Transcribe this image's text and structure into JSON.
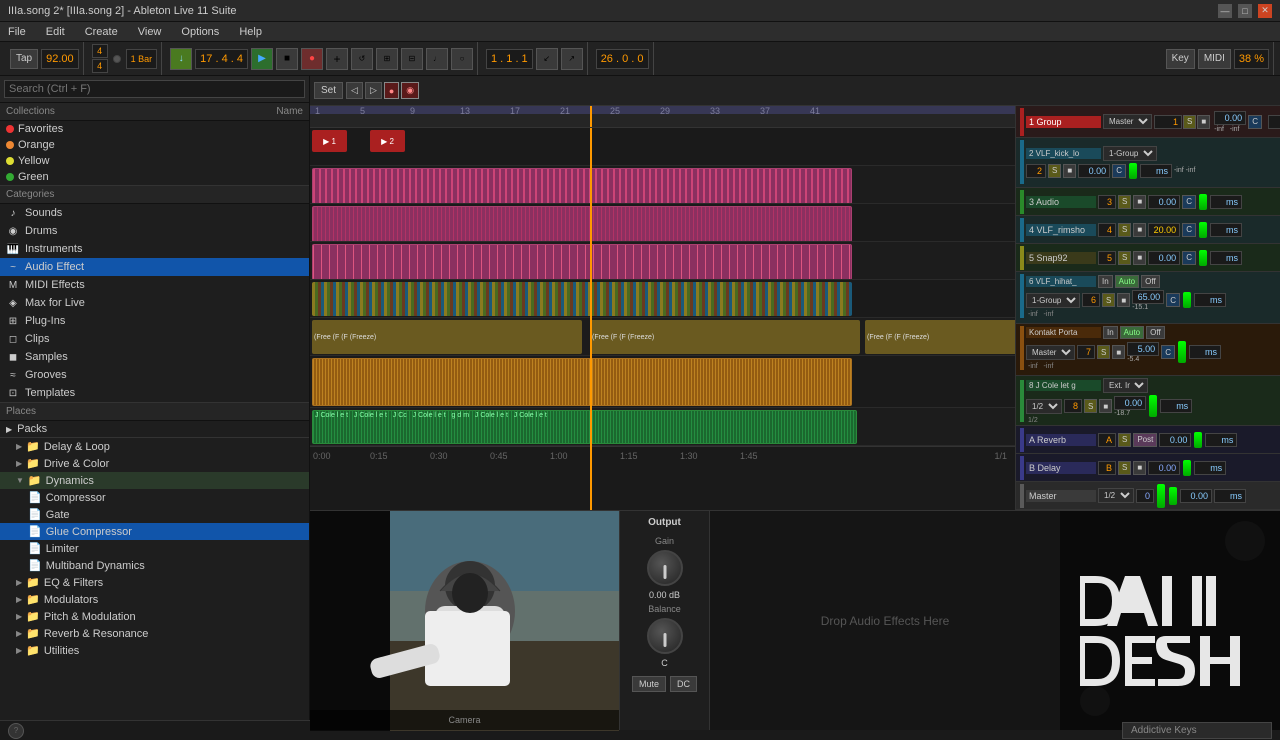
{
  "titlebar": {
    "title": "IIIa.song 2* [IIIa.song 2] - Ableton Live 11 Suite",
    "min": "—",
    "max": "□",
    "close": "✕"
  },
  "menu": {
    "items": [
      "File",
      "Edit",
      "Create",
      "View",
      "Options",
      "Help"
    ]
  },
  "toolbar": {
    "tap": "Tap",
    "bpm": "92.00",
    "time_sig": "4 / 4",
    "loop": "1 Bar",
    "position": "17 . 4 . 4",
    "time_display": "1 . 1 . 1",
    "bar_end": "26 . 0 . 0",
    "zoom": "38 %",
    "key_label": "Key",
    "midi_label": "MIDI"
  },
  "browser": {
    "search_placeholder": "Search (Ctrl + F)",
    "collections_header": "Collections",
    "name_header": "Name",
    "collections": [
      {
        "label": "Favorites",
        "color": "red"
      },
      {
        "label": "Orange",
        "color": "orange"
      },
      {
        "label": "Yellow",
        "color": "yellow"
      },
      {
        "label": "Green",
        "color": "green"
      }
    ],
    "categories_header": "Categories",
    "categories": [
      {
        "label": "Sounds",
        "icon": "♪"
      },
      {
        "label": "Drums",
        "icon": "◉"
      },
      {
        "label": "Instruments",
        "icon": "🎹"
      },
      {
        "label": "Audio Effect",
        "icon": "~"
      },
      {
        "label": "MIDI Effects",
        "icon": "M"
      },
      {
        "label": "Max for Live",
        "icon": "◈"
      },
      {
        "label": "Plug-Ins",
        "icon": "⊞"
      },
      {
        "label": "Clips",
        "icon": "◻"
      },
      {
        "label": "Samples",
        "icon": "◼"
      },
      {
        "label": "Grooves",
        "icon": "≈"
      },
      {
        "label": "Templates",
        "icon": "⊡"
      }
    ],
    "places_header": "Places",
    "places": [
      {
        "label": "Packs",
        "icon": "▶"
      }
    ],
    "tree": {
      "dynamics_folder": "Dynamics",
      "items": [
        "Compressor",
        "Gate",
        "Glue Compressor",
        "Limiter",
        "Multiband Dynamics"
      ],
      "folders": [
        "Delay & Loop",
        "Drive & Color",
        "Dynamics",
        "EQ & Filters",
        "Modulators",
        "Pitch & Modulation",
        "Reverb & Resonance",
        "Utilities"
      ]
    }
  },
  "tracks": [
    {
      "id": 1,
      "name": "1 Group",
      "color": "#8b2020",
      "type": "group"
    },
    {
      "id": 2,
      "name": "2 VLF_kick_lo",
      "color": "#1a6a8a",
      "type": "audio"
    },
    {
      "id": 3,
      "name": "3 Audio",
      "color": "#2a6a2a",
      "type": "audio"
    },
    {
      "id": 4,
      "name": "4 VLF_rimsho",
      "color": "#1a6a8a",
      "type": "audio"
    },
    {
      "id": 5,
      "name": "5 Snap92",
      "color": "#6a6a1a",
      "type": "audio"
    },
    {
      "id": 6,
      "name": "6 VLF_hihat_",
      "color": "#1a6a8a",
      "type": "audio"
    },
    {
      "id": 7,
      "name": "Kontakt Porta",
      "color": "#8a5a10",
      "type": "instrument"
    },
    {
      "id": 8,
      "name": "8 J Cole let g",
      "color": "#1a7a3a",
      "type": "audio"
    },
    {
      "id": "A",
      "name": "A Reverb",
      "color": "#3a3a8a",
      "type": "return"
    },
    {
      "id": "B",
      "name": "B Delay",
      "color": "#3a3a8a",
      "type": "return"
    },
    {
      "id": "M",
      "name": "Master",
      "color": "#5a5a5a",
      "type": "master"
    }
  ],
  "mixer": {
    "master_dropdown": "Master",
    "group_dropdown": "1-Group",
    "track_values": [
      {
        "num": "1",
        "vol": "0.00",
        "ms": "ms",
        "s": "S",
        "c": "C"
      },
      {
        "num": "2",
        "vol": "0.00",
        "ms": "ms",
        "s": "S",
        "c": "C"
      },
      {
        "num": "3",
        "vol": "0.00",
        "ms": "ms",
        "s": "S",
        "c": "C"
      },
      {
        "num": "4",
        "vol": "20.00",
        "ms": "ms",
        "s": "S",
        "c": "C"
      },
      {
        "num": "5",
        "vol": "0.00",
        "ms": "ms",
        "s": "S",
        "c": "C"
      },
      {
        "num": "6",
        "vol": "65.00",
        "ms": "ms",
        "s": "S",
        "c": "C"
      },
      {
        "num": "7",
        "vol": "5.00",
        "ms": "ms",
        "s": "S",
        "c": "C"
      },
      {
        "num": "8",
        "vol": "0.00",
        "ms": "ms",
        "s": "S",
        "c": "C"
      },
      {
        "num": "A",
        "vol": "0.00",
        "ms": "ms",
        "s": "S",
        "suffix": "Post"
      },
      {
        "num": "B",
        "vol": "0.00",
        "ms": "ms",
        "s": "S"
      }
    ],
    "db_values": {
      "group_inf": "-inf",
      "track2": "-inf -inf",
      "track6_top": "-15.1",
      "track6_bot": "-inf -inf",
      "track7_top": "-5.4",
      "track7_bot": "-inf -inf",
      "track8_top": "-18.7",
      "track8_bot": "1/2"
    }
  },
  "output_panel": {
    "title": "Output",
    "gain_label": "Gain",
    "gain_val": "0.00 dB",
    "balance_label": "Balance",
    "balance_val": "C",
    "mute_label": "Mute",
    "dc_label": "DC"
  },
  "effects_area": {
    "drop_text": "Drop Audio Effects Here"
  },
  "clips": {
    "freeze_label": "Freeze",
    "free_label": "Free",
    "f_label": "F",
    "jcole_label": "J Cole l e t",
    "jcole_short": "J Cc"
  },
  "transport": {
    "play": "▶",
    "stop": "■",
    "record": "●"
  },
  "statusbar": {
    "position": "1/1",
    "plugin": "Addictive Keys"
  }
}
